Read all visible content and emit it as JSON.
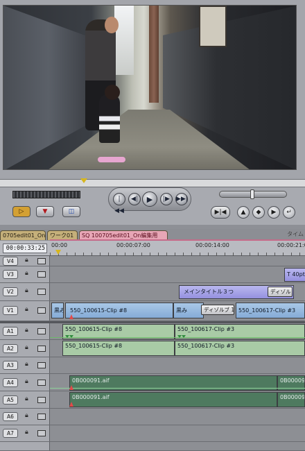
{
  "viewer": {
    "scene": "video frame: grandfather and toddler in narrow alley"
  },
  "transport": {
    "prev_edit": "|◀◀",
    "step_back": "◀|",
    "play": "▶",
    "step_fwd": "|▶",
    "next_edit": "▶▶|",
    "mark_in": "▷",
    "mark_marker": "▼",
    "overlay": "◫",
    "match_frame": "▶|◀",
    "add_marker": "▲",
    "add_keyframe": "◆",
    "mark_clip": "▶",
    "show_match": "↵"
  },
  "timeline": {
    "tabs": [
      {
        "label": "0705edit01_On"
      },
      {
        "label": "ワーク01"
      },
      {
        "label": "SQ 100705edit01_On編集用"
      }
    ],
    "tab_right": "タイム",
    "timecode": "00:00:33:25",
    "ruler": [
      "00:00",
      "00:00:07:00",
      "00:00:14:00",
      "00:00:21:0"
    ],
    "tracks": {
      "v4": "V4",
      "v3": "V3",
      "v2": "V2",
      "v1": "V1",
      "a1": "A1",
      "a2": "A2",
      "a3": "A3",
      "a4": "A4",
      "a5": "A5",
      "a6": "A6",
      "a7": "A7"
    },
    "clips": {
      "v3_title": "T 40pt",
      "v2_title": "メインタイトル３つ",
      "v2_dissolve": "ディゾル",
      "v1_black": "黒み",
      "v1_clip1": "550_100615-Clip #8",
      "v1_black2": "黒み",
      "v1_dissolve": "ディゾルブ 1",
      "v1_clip2": "550_100617-Clip #3",
      "a1_clip1": "550_100615-Clip #8",
      "a1_clip2": "550_100617-Clip #3",
      "a2_clip1": "550_100615-Clip #8",
      "a2_clip2": "550_100617-Clip #3",
      "a4_music": "0B000091.aif",
      "a4_music_end": "0B00009",
      "a5_music": "0B000091.aif",
      "a5_music_end": "0B00009"
    }
  }
}
